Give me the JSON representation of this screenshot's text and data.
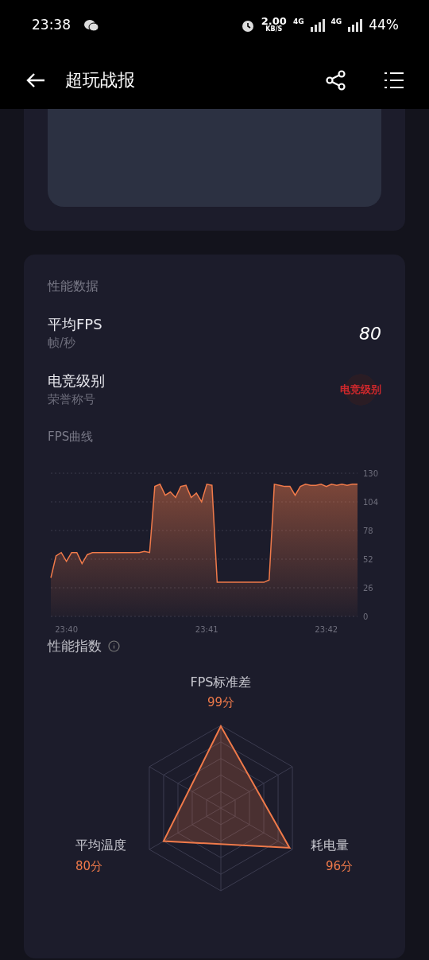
{
  "status_bar": {
    "time": "23:38",
    "speed": "2.00",
    "speed_unit": "KB/S",
    "network_1": "4G",
    "network_2": "4G",
    "battery": "44%"
  },
  "header": {
    "title": "超玩战报"
  },
  "performance": {
    "title": "性能数据",
    "rows": [
      {
        "kind": "number",
        "label": "平均FPS",
        "sub": "帧/秒",
        "value": "80"
      },
      {
        "kind": "badge",
        "label": "电竞级别",
        "sub": "荣誉称号",
        "value": "电竞级别"
      }
    ],
    "fps_title": "FPS曲线",
    "chart_data": {
      "type": "area",
      "grid": true,
      "categories": [
        null,
        null,
        null,
        "23:40",
        null,
        null,
        null,
        null,
        null,
        null,
        null,
        null,
        null,
        null,
        null,
        null,
        null,
        null,
        null,
        null,
        null,
        null,
        null,
        null,
        null,
        null,
        null,
        null,
        null,
        null,
        "23:41",
        null,
        null,
        null,
        null,
        null,
        null,
        null,
        null,
        null,
        null,
        null,
        null,
        null,
        null,
        null,
        null,
        null,
        null,
        null,
        null,
        null,
        null,
        "23:42",
        null,
        null,
        null,
        null,
        null,
        null
      ],
      "ylim": [
        0,
        130
      ],
      "yticks": [
        0,
        26,
        52,
        78,
        104,
        130
      ],
      "series": [
        {
          "color": "#f07a4a",
          "values": [
            35,
            55,
            58,
            50,
            58,
            58,
            48,
            56,
            58,
            58,
            58,
            58,
            58,
            58,
            58,
            58,
            58,
            58,
            59,
            58,
            118,
            120,
            110,
            113,
            108,
            118,
            119,
            108,
            112,
            104,
            120,
            119,
            31,
            31,
            31,
            31,
            31,
            31,
            31,
            31,
            31,
            31,
            33,
            120,
            119,
            118,
            118,
            110,
            118,
            120,
            119,
            119,
            120,
            118,
            120,
            119,
            120,
            119,
            120,
            120
          ]
        }
      ]
    },
    "index_title": "性能指数",
    "metrics": [
      {
        "label": "FPS标准差",
        "score": "99分"
      },
      {
        "label": "平均温度",
        "score": "80分"
      },
      {
        "label": "耗电量",
        "score": "96分"
      }
    ]
  }
}
